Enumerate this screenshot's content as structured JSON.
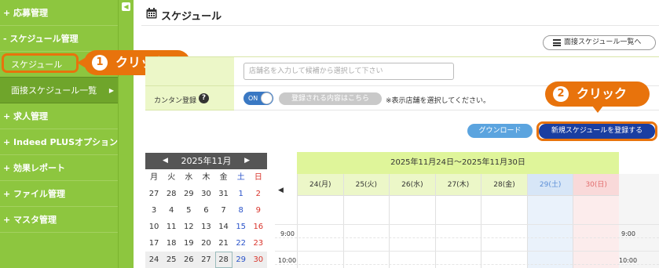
{
  "sidebar": {
    "items": [
      {
        "label": "+ 応募管理"
      },
      {
        "label": "- スケジュール管理"
      },
      {
        "label": "スケジュール"
      },
      {
        "label": "面接スケジュール一覧",
        "arrow": "▶"
      },
      {
        "label": "+ 求人管理"
      },
      {
        "label": "+ Indeed PLUSオプション"
      },
      {
        "label": "+ 効果レポート"
      },
      {
        "label": "+ ファイル管理"
      },
      {
        "label": "+ マスタ管理"
      }
    ],
    "collapse_glyph": "◀"
  },
  "callouts": [
    {
      "number": "1",
      "text": "クリック"
    },
    {
      "number": "2",
      "text": "クリック"
    }
  ],
  "header": {
    "title": "スケジュール",
    "list_button": "面接スケジュール一覧へ"
  },
  "form": {
    "store_placeholder": "店舗名を入力して候補から選択して下さい",
    "easy_register_label": "カンタン登録",
    "help_glyph": "?",
    "toggle_label": "ON",
    "registered_content_button": "登録される内容はこちら",
    "hint": "※表示店舗を選択してください。"
  },
  "actions": {
    "download": "グウンロード",
    "new_schedule": "新規スケジュールを登録する"
  },
  "mini_calendar": {
    "month": "2025年11月",
    "prev": "◀",
    "next": "▶",
    "weekdays": [
      "月",
      "火",
      "水",
      "木",
      "金",
      "土",
      "日"
    ],
    "weeks": [
      [
        "27",
        "28",
        "29",
        "30",
        "31",
        "1",
        "2"
      ],
      [
        "3",
        "4",
        "5",
        "6",
        "7",
        "8",
        "9"
      ],
      [
        "10",
        "11",
        "12",
        "13",
        "14",
        "15",
        "16"
      ],
      [
        "17",
        "18",
        "19",
        "20",
        "21",
        "22",
        "23"
      ],
      [
        "24",
        "25",
        "26",
        "27",
        "28",
        "29",
        "30"
      ]
    ]
  },
  "week_view": {
    "range": "2025年11月24日〜2025年11月30日",
    "prev": "◀",
    "next": "▶",
    "days": [
      "24(月)",
      "25(火)",
      "26(水)",
      "27(木)",
      "28(金)",
      "29(土)",
      "30(日)"
    ],
    "times": [
      "9:00",
      "10:00"
    ]
  },
  "colors": {
    "sidebar": "#8dc63f",
    "accent_orange": "#e8730c",
    "primary_button": "#1a3ea1",
    "download_button": "#5ba4df",
    "week_header": "#dff59a"
  }
}
